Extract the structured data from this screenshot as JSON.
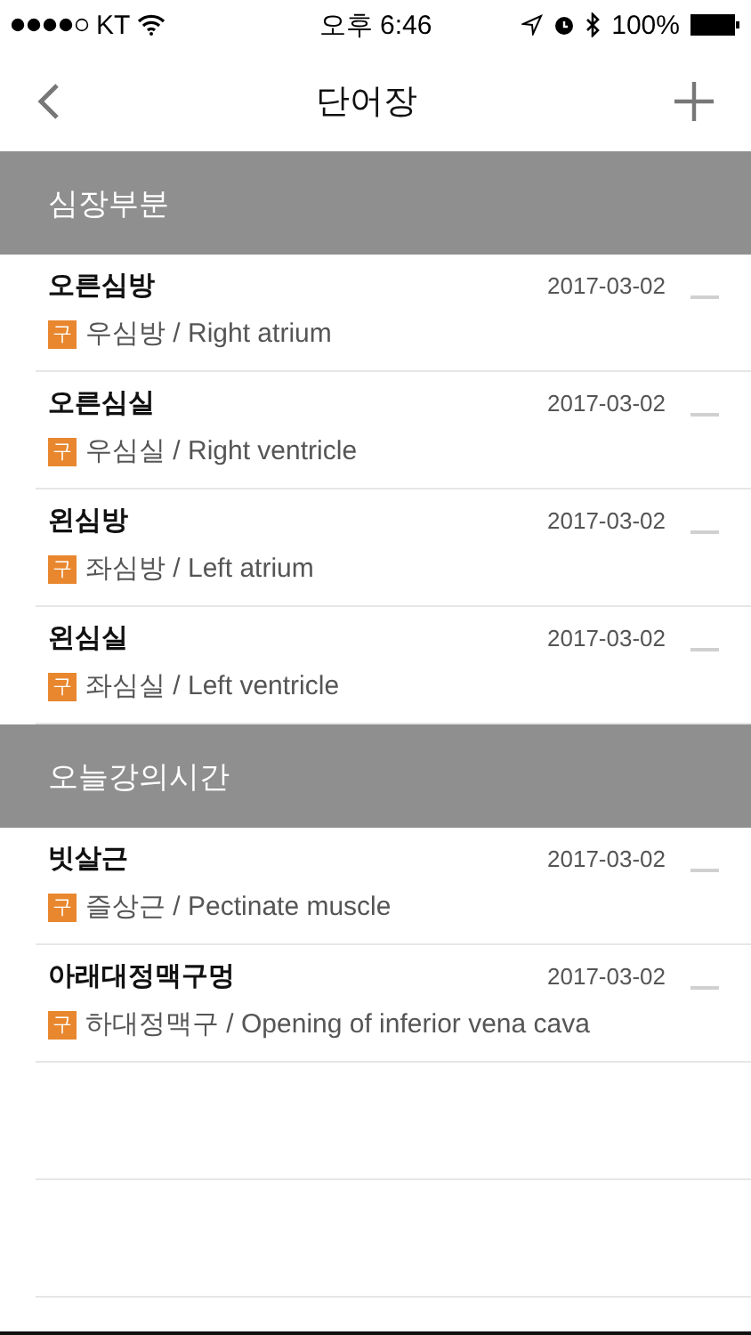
{
  "status_bar": {
    "carrier": "KT",
    "time": "오후 6:46",
    "battery": "100%"
  },
  "nav": {
    "title": "단어장"
  },
  "sections": [
    {
      "title": "심장부분",
      "entries": [
        {
          "word": "오른심방",
          "tag": "구",
          "meaning": "우심방 / Right atrium",
          "date": "2017-03-02"
        },
        {
          "word": "오른심실",
          "tag": "구",
          "meaning": "우심실 / Right ventricle",
          "date": "2017-03-02"
        },
        {
          "word": "왼심방",
          "tag": "구",
          "meaning": "좌심방 / Left atrium",
          "date": "2017-03-02"
        },
        {
          "word": "왼심실",
          "tag": "구",
          "meaning": "좌심실 / Left ventricle",
          "date": "2017-03-02"
        }
      ]
    },
    {
      "title": "오늘강의시간",
      "entries": [
        {
          "word": "빗살근",
          "tag": "구",
          "meaning": "즐상근 / Pectinate muscle",
          "date": "2017-03-02"
        },
        {
          "word": "아래대정맥구멍",
          "tag": "구",
          "meaning": "하대정맥구 / Opening of inferior vena cava",
          "date": "2017-03-02"
        }
      ]
    }
  ]
}
